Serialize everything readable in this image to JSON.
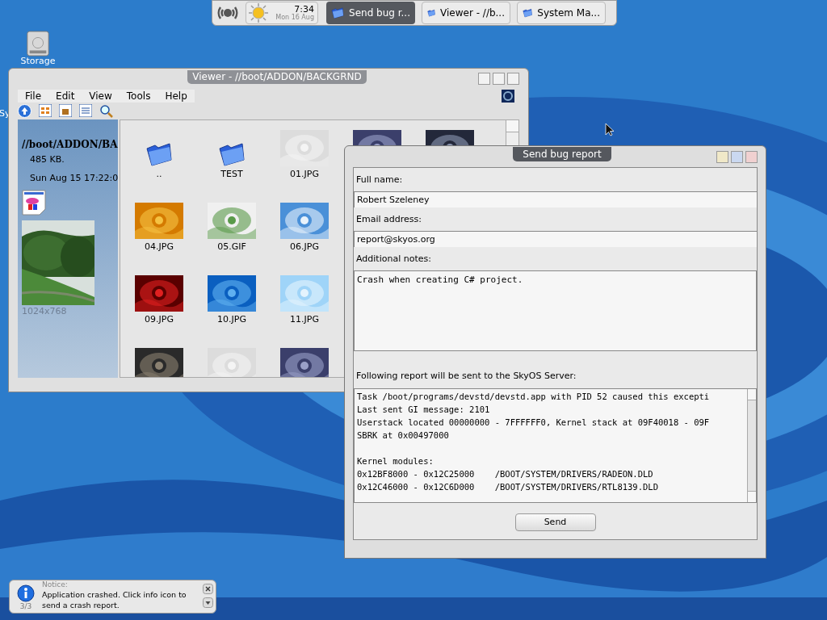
{
  "taskbar": {
    "clock": {
      "time": "7:34",
      "date": "Mon 16 Aug"
    },
    "tasks": [
      {
        "label": "Send bug r...",
        "selected": true
      },
      {
        "label": "Viewer - //b...",
        "selected": false
      },
      {
        "label": "System Ma...",
        "selected": false
      }
    ]
  },
  "desktop_icons": [
    {
      "label": "Storage"
    },
    {
      "label": "Sy"
    }
  ],
  "viewer": {
    "title": "Viewer - //boot/ADDON/BACKGRND",
    "menu": [
      "File",
      "Edit",
      "View",
      "Tools",
      "Help"
    ],
    "sidebar": {
      "path": "//boot/ADDON/BA",
      "size": "485 KB.",
      "date": "Sun Aug 15 17:22:0",
      "dimensions": "1024x768"
    },
    "rows": [
      [
        {
          "kind": "folder",
          "name": ".."
        },
        {
          "kind": "folder",
          "name": "TEST"
        },
        {
          "kind": "picture",
          "name": "01.JPG"
        },
        {
          "kind": "picture"
        },
        {
          "kind": "picture"
        }
      ],
      [
        {
          "kind": "picture",
          "name": "04.JPG"
        },
        {
          "kind": "picture",
          "name": "05.GIF"
        },
        {
          "kind": "picture",
          "name": "06.JPG"
        }
      ],
      [
        {
          "kind": "picture",
          "name": "09.JPG"
        },
        {
          "kind": "picture",
          "name": "10.JPG"
        },
        {
          "kind": "picture",
          "name": "11.JPG"
        }
      ],
      [
        {
          "kind": "picture"
        },
        {
          "kind": "picture"
        },
        {
          "kind": "picture"
        }
      ]
    ]
  },
  "bug_report": {
    "title": "Send bug report",
    "fields": [
      {
        "kind": "line",
        "label": "Full name:",
        "value": "Robert Szeleney"
      },
      {
        "kind": "line",
        "label": "Email address:",
        "value": "report@skyos.org"
      },
      {
        "kind": "area",
        "label": "Additional notes:",
        "value": "Crash when creating C# project."
      }
    ],
    "report_label": "Following report will be sent to the SkyOS Server:",
    "report": [
      [
        "Task /boot/programs/devstd/devstd.app with PID 52 caused this excepti",
        "Last sent GI message: 2101",
        "Userstack located 00000000 - 7FFFFFF0, Kernel stack at 09F40018 - 09F",
        "SBRK at 0x00497000"
      ],
      [
        "Kernel modules:",
        "0x12BF8000 - 0x12C25000    /BOOT/SYSTEM/DRIVERS/RADEON.DLD",
        "0x12C46000 - 0x12C6D000    /BOOT/SYSTEM/DRIVERS/RTL8139.DLD"
      ]
    ],
    "send": "Send"
  },
  "notification": {
    "heading": "Notice:",
    "message": "Application crashed. Click info icon to send a crash report.",
    "counter": "3/3"
  }
}
